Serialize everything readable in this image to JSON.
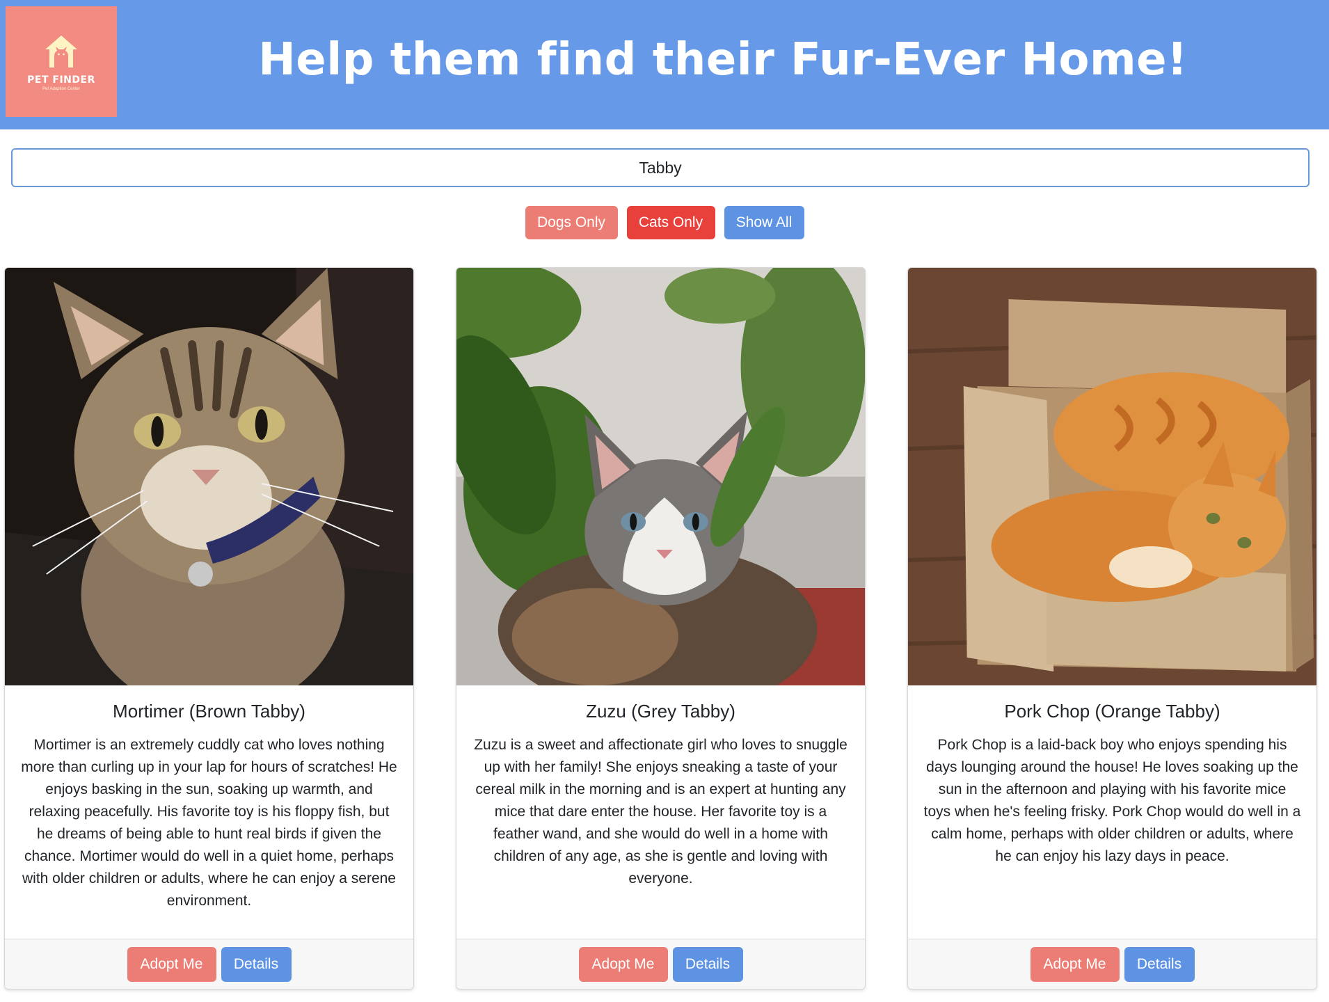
{
  "logo": {
    "title": "PET FINDER",
    "subtitle": "Pet Adoption Center",
    "icon": "house-cat-icon"
  },
  "header": {
    "headline": "Help them find their Fur-Ever Home!",
    "background": "#6699e8"
  },
  "search": {
    "value": "Tabby"
  },
  "filters": {
    "dogs_label": "Dogs Only",
    "cats_label": "Cats Only",
    "all_label": "Show All"
  },
  "pets": [
    {
      "name": "Mortimer (Brown Tabby)",
      "description": "Mortimer is an extremely cuddly cat who loves nothing more than curling up in your lap for hours of scratches! He enjoys basking in the sun, soaking up warmth, and relaxing peacefully. His favorite toy is his floppy fish, but he dreams of being able to hunt real birds if given the chance. Mortimer would do well in a quiet home, perhaps with older children or adults, where he can enjoy a serene environment.",
      "adopt_label": "Adopt Me",
      "details_label": "Details"
    },
    {
      "name": "Zuzu (Grey Tabby)",
      "description": "Zuzu is a sweet and affectionate girl who loves to snuggle up with her family! She enjoys sneaking a taste of your cereal milk in the morning and is an expert at hunting any mice that dare enter the house. Her favorite toy is a feather wand, and she would do well in a home with children of any age, as she is gentle and loving with everyone.",
      "adopt_label": "Adopt Me",
      "details_label": "Details"
    },
    {
      "name": "Pork Chop (Orange Tabby)",
      "description": "Pork Chop is a laid-back boy who enjoys spending his days lounging around the house! He loves soaking up the sun in the afternoon and playing with his favorite mice toys when he's feeling frisky. Pork Chop would do well in a calm home, perhaps with older children or adults, where he can enjoy his lazy days in peace.",
      "adopt_label": "Adopt Me",
      "details_label": "Details"
    }
  ],
  "colors": {
    "logo_bg": "#f28b82",
    "adopt": "#ec7d75",
    "cats_active": "#e8413c",
    "primary": "#5e93e4"
  }
}
